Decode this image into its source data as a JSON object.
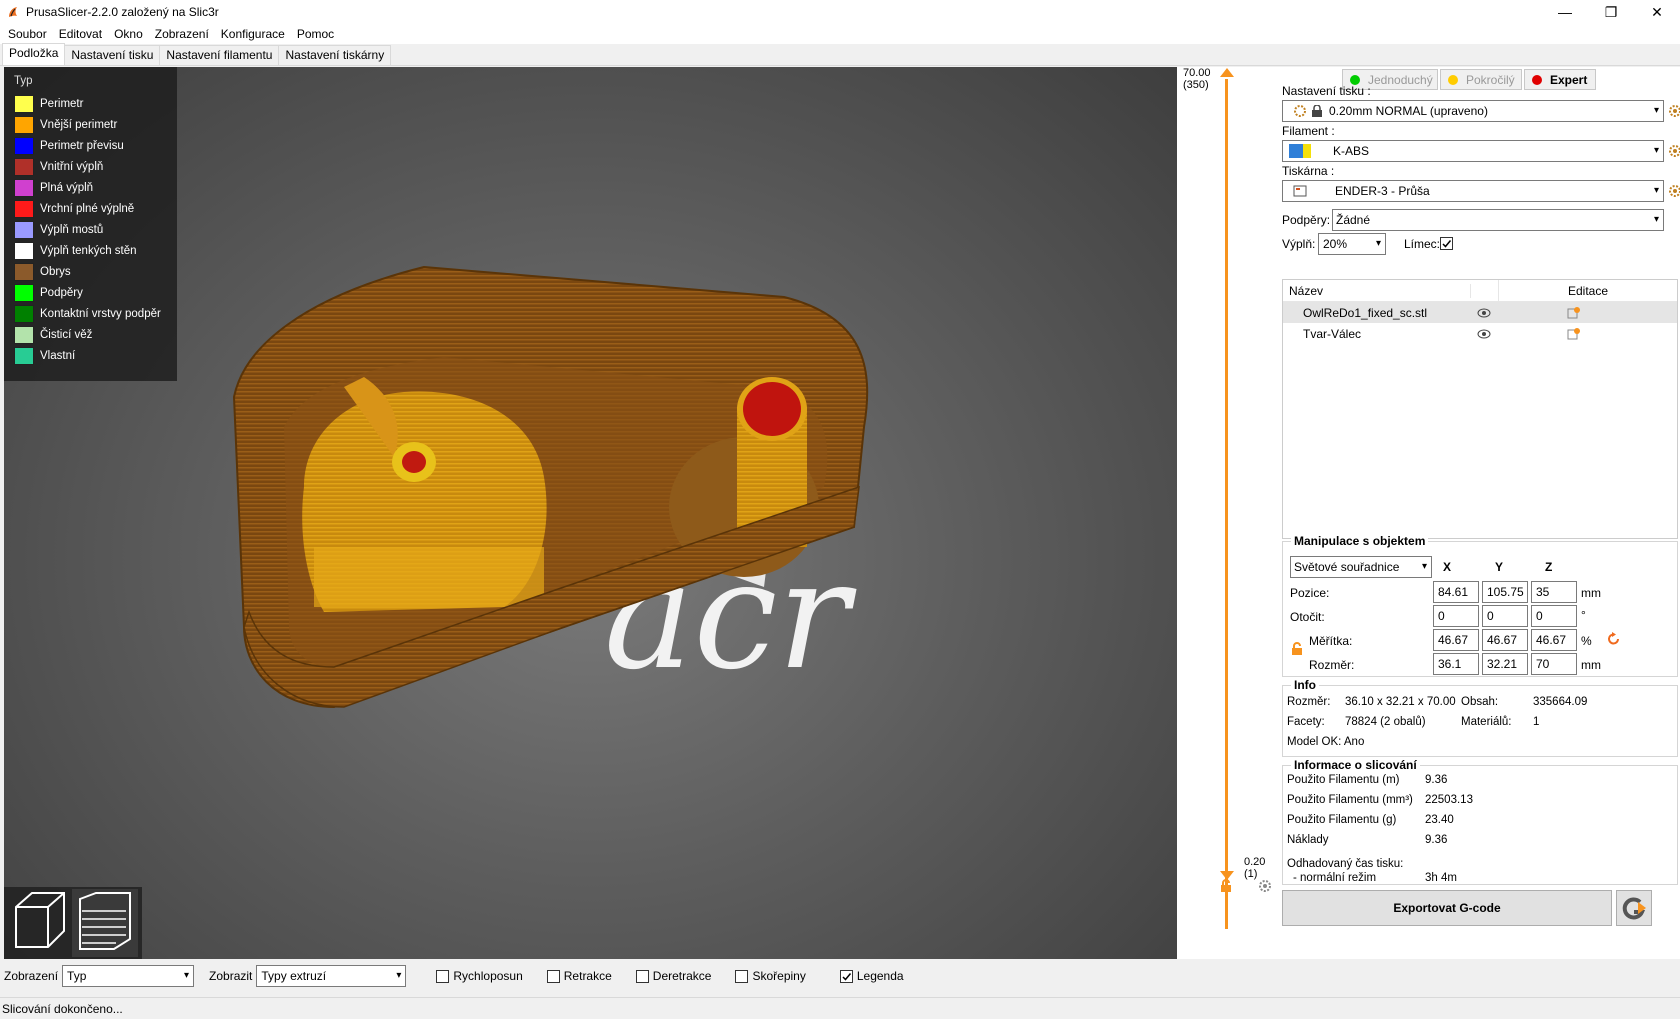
{
  "window": {
    "title": "PrusaSlicer-2.2.0 založený na Slic3r",
    "minimize": "—",
    "maximize": "❐",
    "close": "✕"
  },
  "menu": [
    "Soubor",
    "Editovat",
    "Okno",
    "Zobrazení",
    "Konfigurace",
    "Pomoc"
  ],
  "tabs": [
    "Podložka",
    "Nastavení tisku",
    "Nastavení filamentu",
    "Nastavení tiskárny"
  ],
  "legend": {
    "title": "Typ",
    "items": [
      {
        "label": "Perimetr",
        "color": "#ffff4d"
      },
      {
        "label": "Vnější perimetr",
        "color": "#ffa500"
      },
      {
        "label": "Perimetr převisu",
        "color": "#0000ff"
      },
      {
        "label": "Vnitřní výplň",
        "color": "#b03029"
      },
      {
        "label": "Plná výplň",
        "color": "#d040cf"
      },
      {
        "label": "Vrchní plné výplně",
        "color": "#ff1a1a"
      },
      {
        "label": "Výplň mostů",
        "color": "#9a9aff"
      },
      {
        "label": "Výplň tenkých stěn",
        "color": "#ffffff"
      },
      {
        "label": "Obrys",
        "color": "#8b5a2b"
      },
      {
        "label": "Podpěry",
        "color": "#00ff00"
      },
      {
        "label": "Kontaktní vrstvy podpěr",
        "color": "#008000"
      },
      {
        "label": "Čisticí věž",
        "color": "#b3e3ab"
      },
      {
        "label": "Vlastní",
        "color": "#28cc94"
      }
    ]
  },
  "viewport": {
    "watermark": "acr"
  },
  "slider": {
    "top_value": "70.00",
    "top_layer": "(350)",
    "bottom_value": "0.20",
    "bottom_layer": "(1)"
  },
  "modes": {
    "simple": "Jednoduchý",
    "advanced": "Pokročilý",
    "expert": "Expert"
  },
  "print_settings": {
    "label": "Nastavení tisku :",
    "value": "0.20mm NORMAL (upraveno)"
  },
  "filament": {
    "label": "Filament :",
    "value": "K-ABS"
  },
  "printer": {
    "label": "Tiskárna :",
    "value": "ENDER-3 - Průša"
  },
  "supports": {
    "label": "Podpěry:",
    "value": "Žádné"
  },
  "infill": {
    "label": "Výplň:",
    "value": "20%"
  },
  "brim": {
    "label": "Límec:"
  },
  "object_list": {
    "col_name": "Název",
    "col_edit": "Editace",
    "rows": [
      {
        "name": "OwlReDo1_fixed_sc.stl"
      },
      {
        "name": "Tvar-Válec"
      }
    ]
  },
  "manipulation": {
    "title": "Manipulace s objektem",
    "coord_system": "Světové souřadnice",
    "axes": [
      "X",
      "Y",
      "Z"
    ],
    "position": {
      "label": "Pozice:",
      "x": "84.61",
      "y": "105.75",
      "z": "35",
      "unit": "mm"
    },
    "rotation": {
      "label": "Otočit:",
      "x": "0",
      "y": "0",
      "z": "0",
      "unit": "°"
    },
    "scale": {
      "label": "Měřítka:",
      "x": "46.67",
      "y": "46.67",
      "z": "46.67",
      "unit": "%"
    },
    "size": {
      "label": "Rozměr:",
      "x": "36.1",
      "y": "32.21",
      "z": "70",
      "unit": "mm"
    }
  },
  "info": {
    "title": "Info",
    "size_label": "Rozměr:",
    "size_value": "36.10 x 32.21 x 70.00",
    "volume_label": "Obsah:",
    "volume_value": "335664.09",
    "facets_label": "Facety:",
    "facets_value": "78824 (2 obalů)",
    "materials_label": "Materiálů:",
    "materials_value": "1",
    "model_ok": "Model OK: Ano"
  },
  "slicing": {
    "title": "Informace o slicování",
    "rows": [
      {
        "label": "Použito Filamentu (m)",
        "value": "9.36"
      },
      {
        "label": "Použito Filamentu (mm³)",
        "value": "22503.13"
      },
      {
        "label": "Použito Filamentu (g)",
        "value": "23.40"
      },
      {
        "label": "Náklady",
        "value": "9.36"
      }
    ],
    "time_label": "Odhadovaný čas tisku:",
    "mode_label": "- normální režim",
    "mode_value": "3h 4m"
  },
  "export": {
    "label": "Exportovat G-code"
  },
  "bottom": {
    "view_label": "Zobrazení",
    "view_value": "Typ",
    "show_label": "Zobrazit",
    "show_value": "Typy extruzí",
    "checks": [
      {
        "label": "Rychloposun",
        "checked": false
      },
      {
        "label": "Retrakce",
        "checked": false
      },
      {
        "label": "Deretrakce",
        "checked": false
      },
      {
        "label": "Skořepiny",
        "checked": false
      },
      {
        "label": "Legenda",
        "checked": true
      }
    ]
  },
  "status": "Slicování dokončeno..."
}
